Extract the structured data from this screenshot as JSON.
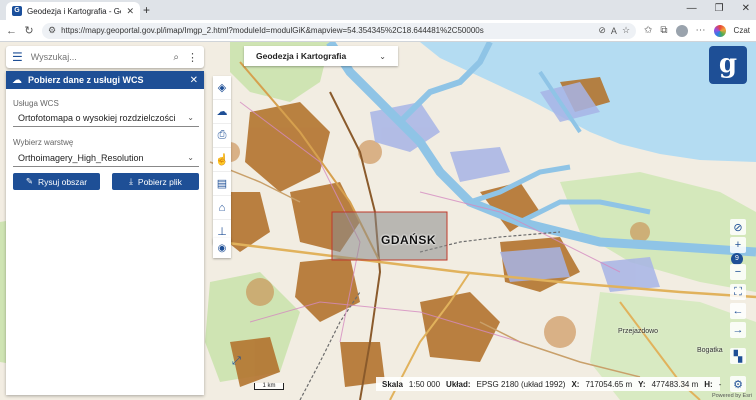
{
  "browser": {
    "tab_title": "Geodezja i Kartografia - Geoportal",
    "url": "https://mapy.geoportal.gov.pl/imap/Imgp_2.html?moduleId=modulGiK&mapview=54.354345%2C18.644481%2C50000s",
    "czat_label": "Czat"
  },
  "search": {
    "placeholder": "Wyszukaj..."
  },
  "panel": {
    "title": "Pobierz dane z usługi WCS",
    "service_label": "Usługa WCS",
    "service_value": "Ortofotomapa o wysokiej rozdzielczości",
    "layer_label": "Wybierz warstwę",
    "layer_value": "Orthoimagery_High_Resolution",
    "draw_button": "Rysuj obszar",
    "download_button": "Pobierz plik"
  },
  "layer_dropdown": {
    "value": "Geodezja i Kartografia"
  },
  "map": {
    "city_label": "GDAŃSK",
    "places": [
      "Przejazdowo",
      "Bogatka"
    ],
    "zoom_level": "9",
    "scalebar_label": "1 km"
  },
  "status": {
    "scale_label": "Skala",
    "scale_value": "1:50 000",
    "crs_label": "Układ:",
    "crs_value": "EPSG 2180 (układ 1992)",
    "x_label": "X:",
    "x_value": "717054.65 m",
    "y_label": "Y:",
    "y_value": "477483.34 m",
    "h_label": "H:",
    "h_value": "-"
  },
  "powered_by": "Powered by Esri",
  "colors": {
    "primary": "#1e4f96",
    "water": "#a9d3ef",
    "urban": "#b3742f",
    "forest": "#c6dfa6",
    "selection": "#8a8a8a"
  }
}
